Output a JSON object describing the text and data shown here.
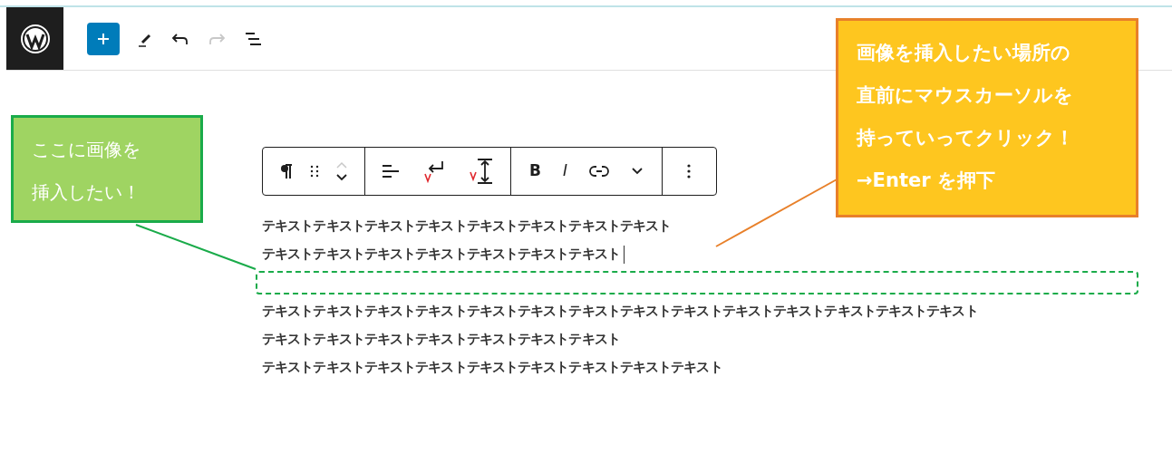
{
  "toolbar_top": {
    "add_selected": true,
    "redo_disabled": true
  },
  "block_toolbar": {
    "move_up_disabled": true,
    "bold": "B",
    "italic": "I"
  },
  "paragraphs": [
    {
      "kind": "text",
      "text": "テキストテキストテキストテキストテキストテキストテキストテキスト"
    },
    {
      "kind": "text",
      "text": "テキストテキストテキストテキストテキストテキストテキスト",
      "cursor": true
    },
    {
      "kind": "insert_point"
    },
    {
      "kind": "text",
      "text": "テキストテキストテキストテキストテキストテキストテキストテキストテキストテキストテキストテキストテキストテキスト"
    },
    {
      "kind": "text",
      "text": "テキストテキストテキストテキストテキストテキストテキスト"
    },
    {
      "kind": "text",
      "text": "テキストテキストテキストテキストテキストテキストテキストテキストテキスト"
    }
  ],
  "callouts": [
    {
      "kind": "green",
      "lines": [
        "ここに画像を",
        "挿入したい！"
      ]
    },
    {
      "kind": "orange",
      "lines": [
        "画像を挿入したい場所の",
        "直前にマウスカーソルを",
        "持っていってクリック！",
        "→Enter を押下"
      ]
    }
  ]
}
